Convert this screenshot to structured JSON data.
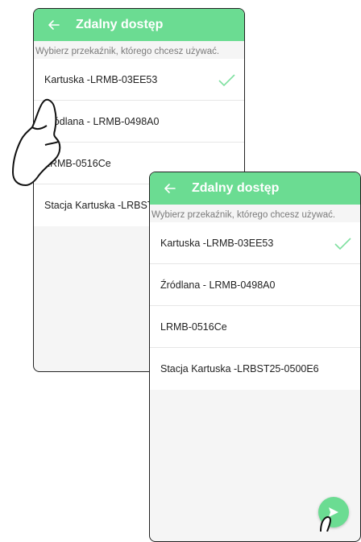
{
  "screen_back": {
    "title": "Zdalny dostęp",
    "subtitle": "Wybierz przekaźnik, którego chcesz używać.",
    "items": [
      {
        "label": "Kartuska -LRMB-03EE53",
        "selected": true
      },
      {
        "label": "Źródlana - LRMB-0498A0",
        "selected": false
      },
      {
        "label": "LRMB-0516Ce",
        "selected": false
      },
      {
        "label": "Stacja Kartuska -LRBST25-0500E6",
        "selected": false
      }
    ]
  },
  "screen_front": {
    "title": "Zdalny dostęp",
    "subtitle": "Wybierz przekaźnik, którego chcesz używać.",
    "items": [
      {
        "label": "Kartuska -LRMB-03EE53",
        "selected": true
      },
      {
        "label": "Źródlana - LRMB-0498A0",
        "selected": false
      },
      {
        "label": "LRMB-0516Ce",
        "selected": false
      },
      {
        "label": "Stacja Kartuska -LRBST25-0500E6",
        "selected": false
      }
    ]
  },
  "colors": {
    "accent": "#6bdc92",
    "check": "#7fe0a0"
  },
  "icons": {
    "back": "arrow-left-icon",
    "check": "check-icon",
    "fab": "send-icon"
  }
}
